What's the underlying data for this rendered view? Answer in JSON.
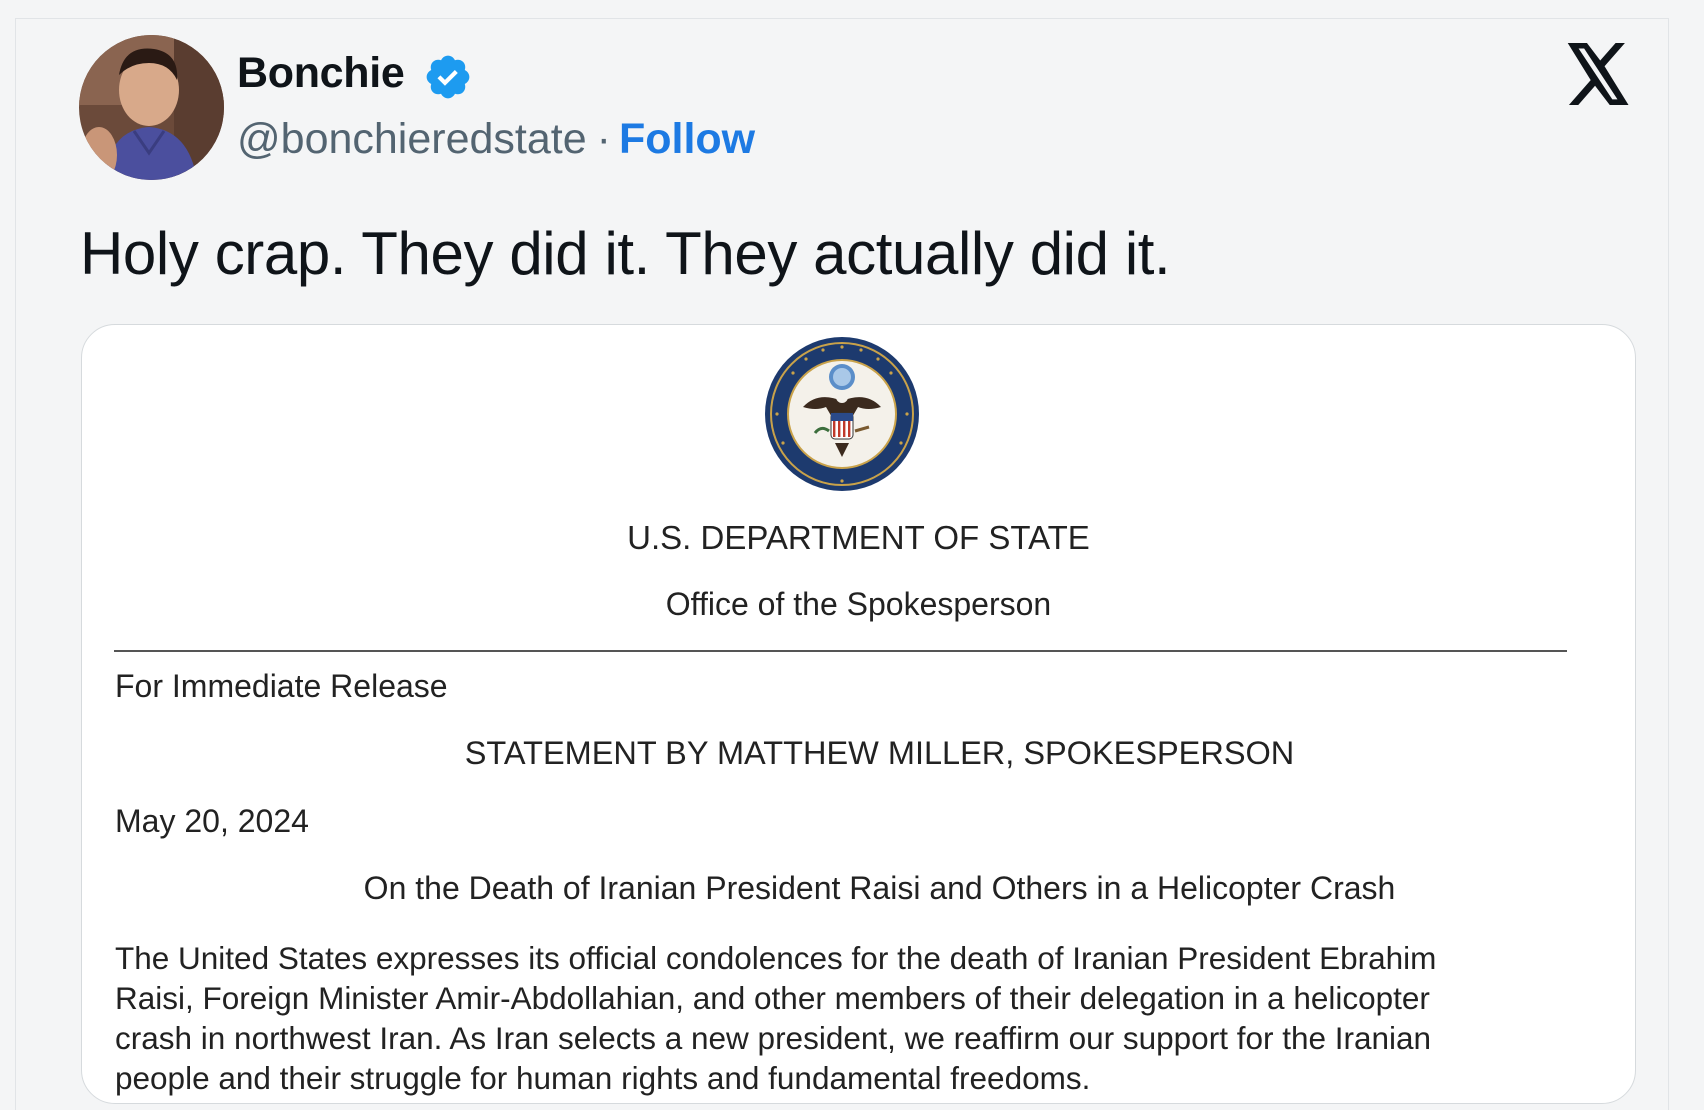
{
  "author": {
    "display_name": "Bonchie",
    "handle": "@bonchieredstate",
    "separator": "·",
    "follow_label": "Follow",
    "verified": true
  },
  "platform_icon": "x-logo-icon",
  "tweet": {
    "text": "Holy crap. They did it. They actually did it."
  },
  "document": {
    "seal_icon": "department-of-state-seal",
    "seal_text": "DEPARTMENT OF STATE · UNITED STATES OF AMERICA",
    "department": "U.S. DEPARTMENT OF STATE",
    "office": "Office of the Spokesperson",
    "release": "For Immediate Release",
    "statement_title": "STATEMENT BY MATTHEW MILLER, SPOKESPERSON",
    "date": "May 20, 2024",
    "subject": "On the Death of Iranian President Raisi and Others in a Helicopter Crash",
    "body": "The United States expresses its official condolences for the death of Iranian President Ebrahim Raisi, Foreign Minister Amir-Abdollahian, and other members of their delegation in a helicopter crash in northwest Iran.  As Iran selects a new president, we reaffirm our support for the Iranian people and their struggle for human rights and fundamental freedoms."
  },
  "colors": {
    "accent": "#1d7ae3",
    "verified_badge": "#1d9bf0",
    "text_primary": "#0f1419",
    "text_secondary": "#536471"
  }
}
